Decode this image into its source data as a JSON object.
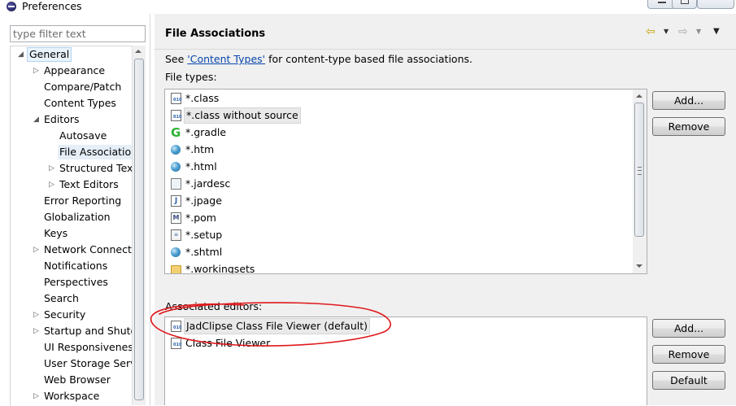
{
  "window": {
    "title": "Preferences"
  },
  "left": {
    "filter_placeholder": "type filter text",
    "tree": [
      {
        "label": "General",
        "indent": 0,
        "twisty": "expanded",
        "selected": true
      },
      {
        "label": "Appearance",
        "indent": 1,
        "twisty": "collapsed"
      },
      {
        "label": "Compare/Patch",
        "indent": 1,
        "twisty": "none"
      },
      {
        "label": "Content Types",
        "indent": 1,
        "twisty": "none"
      },
      {
        "label": "Editors",
        "indent": 1,
        "twisty": "expanded"
      },
      {
        "label": "Autosave",
        "indent": 2,
        "twisty": "none"
      },
      {
        "label": "File Associations",
        "indent": 2,
        "twisty": "none",
        "current": true
      },
      {
        "label": "Structured Text Editors",
        "indent": 2,
        "twisty": "collapsed"
      },
      {
        "label": "Text Editors",
        "indent": 2,
        "twisty": "collapsed"
      },
      {
        "label": "Error Reporting",
        "indent": 1,
        "twisty": "none"
      },
      {
        "label": "Globalization",
        "indent": 1,
        "twisty": "none"
      },
      {
        "label": "Keys",
        "indent": 1,
        "twisty": "none"
      },
      {
        "label": "Network Connections",
        "indent": 1,
        "twisty": "collapsed"
      },
      {
        "label": "Notifications",
        "indent": 1,
        "twisty": "none"
      },
      {
        "label": "Perspectives",
        "indent": 1,
        "twisty": "none"
      },
      {
        "label": "Search",
        "indent": 1,
        "twisty": "none"
      },
      {
        "label": "Security",
        "indent": 1,
        "twisty": "collapsed"
      },
      {
        "label": "Startup and Shutdown",
        "indent": 1,
        "twisty": "collapsed"
      },
      {
        "label": "UI Responsiveness Monitoring",
        "indent": 1,
        "twisty": "none"
      },
      {
        "label": "User Storage Service",
        "indent": 1,
        "twisty": "none"
      },
      {
        "label": "Web Browser",
        "indent": 1,
        "twisty": "none"
      },
      {
        "label": "Workspace",
        "indent": 1,
        "twisty": "collapsed"
      }
    ]
  },
  "page": {
    "title": "File Associations",
    "see_prefix": "See ",
    "see_link": "'Content Types'",
    "see_suffix": " for content-type based file associations.",
    "file_types_label": "File types:",
    "file_types": [
      {
        "label": "*.class",
        "icon": "class-file-icon"
      },
      {
        "label": "*.class without source",
        "icon": "class-file-icon",
        "selected": true
      },
      {
        "label": "*.gradle",
        "icon": "gradle-icon"
      },
      {
        "label": "*.htm",
        "icon": "globe-icon"
      },
      {
        "label": "*.html",
        "icon": "globe-icon"
      },
      {
        "label": "*.jardesc",
        "icon": "jar-description-icon"
      },
      {
        "label": "*.jpage",
        "icon": "java-page-icon"
      },
      {
        "label": "*.pom",
        "icon": "maven-pom-icon"
      },
      {
        "label": "*.setup",
        "icon": "setup-file-icon"
      },
      {
        "label": "*.shtml",
        "icon": "globe-icon"
      },
      {
        "label": "*.workingsets",
        "icon": "folder-icon"
      }
    ],
    "file_type_buttons": {
      "add": "Add...",
      "remove": "Remove"
    },
    "associated_label": "Associated editors:",
    "associated_editors": [
      {
        "label": "JadClipse Class File Viewer (default)",
        "icon": "class-file-icon",
        "selected": true
      },
      {
        "label": "Class File Viewer",
        "icon": "class-file-icon"
      }
    ],
    "editor_buttons": {
      "add": "Add...",
      "remove": "Remove",
      "default": "Default"
    }
  },
  "colors": {
    "annotation": "#e0191c",
    "link": "#0645ad",
    "nav_back": "#c8a000"
  }
}
